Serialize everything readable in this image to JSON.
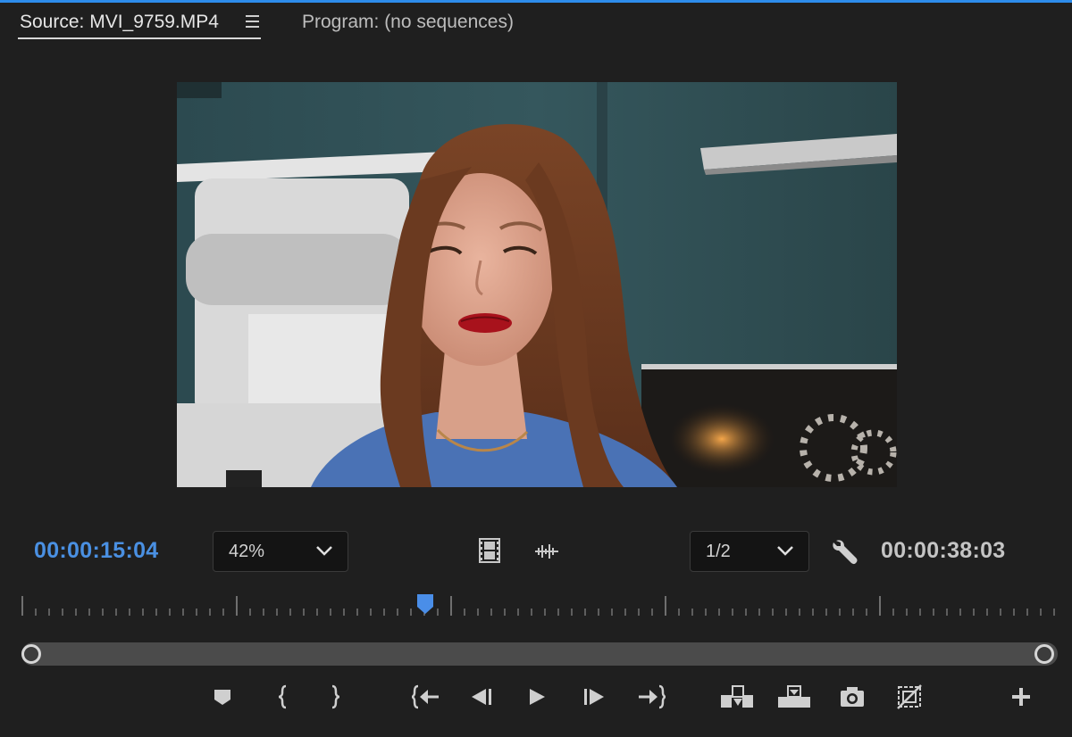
{
  "tabs": {
    "source_label": "Source: MVI_9759.MP4",
    "program_label": "Program: (no sequences)",
    "menu_icon": "hamburger-menu-icon"
  },
  "monitor": {
    "current_timecode": "00:00:15:04",
    "duration_timecode": "00:00:38:03",
    "zoom_value": "42%",
    "resolution_value": "1/2",
    "playhead_position_fraction": 0.39
  },
  "colors": {
    "accent": "#2d8ceb",
    "timecode_blue": "#4a90e2",
    "panel_bg": "#1f1f1f"
  },
  "icons": {
    "drag_video": "film-strip-icon",
    "drag_audio": "audio-waveform-icon",
    "settings": "wrench-icon",
    "transport": [
      "add-marker-icon",
      "mark-in-icon",
      "mark-out-icon",
      "go-to-in-icon",
      "step-back-icon",
      "play-icon",
      "step-forward-icon",
      "go-to-out-icon",
      "insert-icon",
      "overwrite-icon",
      "export-frame-icon",
      "safe-margins-icon",
      "add-button-icon"
    ]
  }
}
